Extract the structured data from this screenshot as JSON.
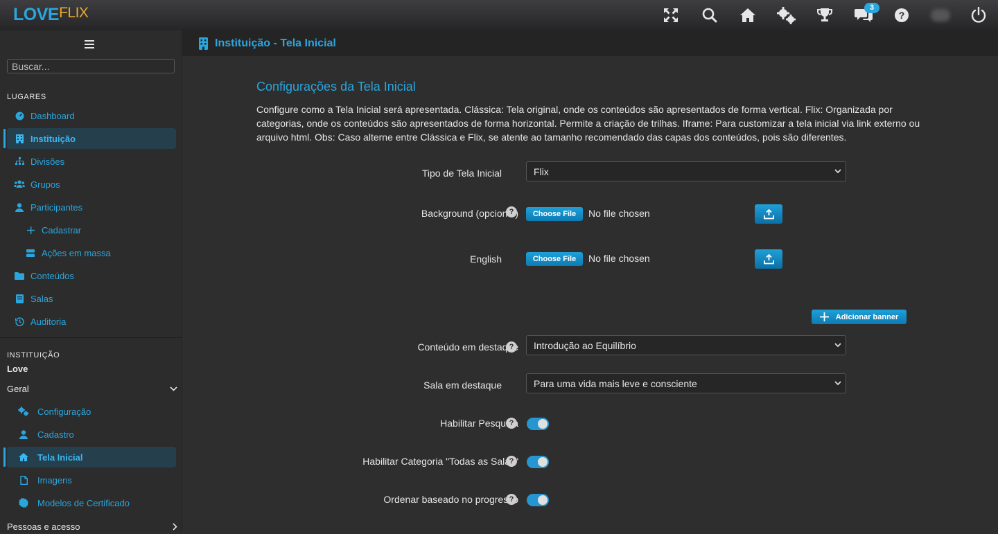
{
  "brand": {
    "love": "LOVE",
    "flix": "FLIX"
  },
  "topbar": {
    "icons": [
      "fullscreen-icon",
      "search-icon",
      "home-icon",
      "settings-icon",
      "trophy-icon",
      "chat-icon",
      "help-icon",
      "avatar",
      "power-icon"
    ],
    "chat_badge": "3"
  },
  "sidebar": {
    "search_placeholder": "Buscar...",
    "places_label": "LUGARES",
    "places": [
      {
        "label": "Dashboard",
        "icon": "dashboard-icon"
      },
      {
        "label": "Instituição",
        "icon": "building-icon",
        "active": true
      },
      {
        "label": "Divisões",
        "icon": "sitemap-icon"
      },
      {
        "label": "Grupos",
        "icon": "users-icon"
      },
      {
        "label": "Participantes",
        "icon": "user-icon"
      },
      {
        "label": "Cadastrar",
        "icon": "plus-icon"
      },
      {
        "label": "Ações em massa",
        "icon": "server-icon"
      },
      {
        "label": "Conteúdos",
        "icon": "folder-icon"
      },
      {
        "label": "Salas",
        "icon": "book-icon"
      },
      {
        "label": "Auditoria",
        "icon": "history-icon"
      }
    ],
    "institution_label": "INSTITUIÇÃO",
    "institution_name": "Love",
    "group_general": "Geral",
    "general_items": [
      {
        "label": "Configuração",
        "icon": "cogs-icon"
      },
      {
        "label": "Cadastro",
        "icon": "user-icon"
      },
      {
        "label": "Tela Inicial",
        "icon": "home-icon",
        "active": true
      },
      {
        "label": "Imagens",
        "icon": "file-icon"
      },
      {
        "label": "Modelos de Certificado",
        "icon": "certificate-icon"
      }
    ],
    "group_people": "Pessoas e acesso"
  },
  "page_header": {
    "title": "Instituição - Tela Inicial"
  },
  "main": {
    "title": "Configurações da Tela Inicial",
    "description": "Configure como a Tela Inicial será apresentada. Clássica: Tela original, onde os conteúdos são apresentados de forma vertical. Flix: Organizada por categorias, onde os conteúdos são apresentados de forma horizontal. Permite a criação de trilhas. Iframe: Para customizar a tela inicial via link externo ou arquivo html. Obs: Caso alterne entre Clássica e Flix, se atente ao tamanho recomendado das capas dos conteúdos, pois são diferentes.",
    "home_type": {
      "label": "Tipo de Tela Inicial",
      "value": "Flix"
    },
    "background": {
      "label": "Background (opcional)",
      "button": "Choose File",
      "status": "No file chosen"
    },
    "english": {
      "label": "English",
      "button": "Choose File",
      "status": "No file chosen"
    },
    "add_banner": "Adicionar banner",
    "featured_content": {
      "label": "Conteúdo em destaque",
      "value": "Introdução ao Equilíbrio"
    },
    "featured_room": {
      "label": "Sala em destaque",
      "value": "Para uma vida mais leve e consciente"
    },
    "enable_search": {
      "label": "Habilitar Pesquisa",
      "on": true
    },
    "enable_all_rooms": {
      "label": "Habilitar Categoria \"Todas as Salas\"",
      "on": true
    },
    "order_progress": {
      "label": "Ordenar baseado no progresso",
      "on": true
    }
  },
  "colors": {
    "accent": "#2aa6de",
    "logo_flix": "#e8a92c",
    "active_bg": "#253f4d"
  }
}
